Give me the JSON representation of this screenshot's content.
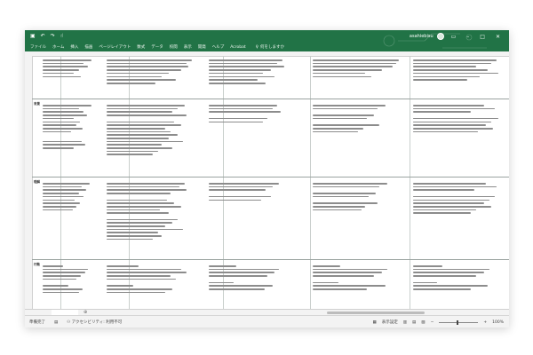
{
  "titlebar": {
    "username": "asahiebisu",
    "qa_icons": [
      "save-icon",
      "undo-icon",
      "redo-icon",
      "touch-icon"
    ]
  },
  "ribbon_tabs": [
    "ファイル",
    "ホーム",
    "挿入",
    "描画",
    "ページレイアウト",
    "数式",
    "データ",
    "校閲",
    "表示",
    "開発",
    "ヘルプ",
    "Acrobat"
  ],
  "ribbon_search": "何をしますか",
  "rows": [
    {
      "label": ""
    },
    {
      "label": "背景"
    },
    {
      "label": "理解"
    },
    {
      "label": "行動"
    }
  ],
  "status": {
    "ready": "準備完了",
    "accessibility": "アクセシビリティ: 利用不可",
    "display_settings": "表示設定",
    "zoom": "100%"
  }
}
